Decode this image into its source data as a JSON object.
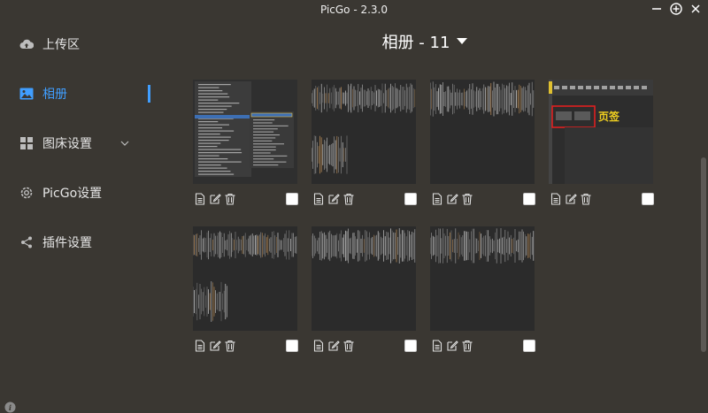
{
  "window": {
    "title": "PicGo - 2.3.0"
  },
  "sidebar": {
    "items": [
      {
        "label": "上传区",
        "icon": "cloud-upload-icon"
      },
      {
        "label": "相册",
        "icon": "image-icon",
        "active": true
      },
      {
        "label": "图床设置",
        "icon": "grid-icon"
      },
      {
        "label": "PicGo设置",
        "icon": "gear-icon"
      },
      {
        "label": "插件设置",
        "icon": "share-icon"
      }
    ]
  },
  "gallery": {
    "title": "相册 - 11",
    "accent": "#409eff",
    "images": [
      {
        "kind": "menu"
      },
      {
        "kind": "waveform"
      },
      {
        "kind": "waveform"
      },
      {
        "kind": "editor",
        "highlight_text": "页签"
      },
      {
        "kind": "waveform"
      },
      {
        "kind": "waveform"
      },
      {
        "kind": "waveform"
      }
    ]
  }
}
